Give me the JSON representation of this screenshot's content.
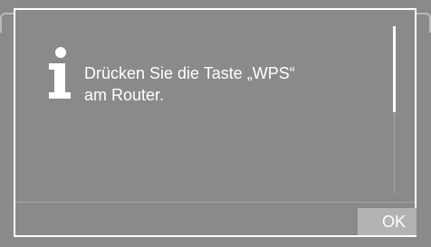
{
  "dialog": {
    "icon": "info-icon",
    "message_lines": [
      "Drücken Sie die Taste „WPS“",
      "am Router."
    ],
    "ok_label": "OK"
  },
  "colors": {
    "background": "#8a8a8a",
    "dialog_border": "#ffffff",
    "text": "#ffffff",
    "button": "#b3b3b3",
    "scroll_track": "#a7a7a7"
  }
}
